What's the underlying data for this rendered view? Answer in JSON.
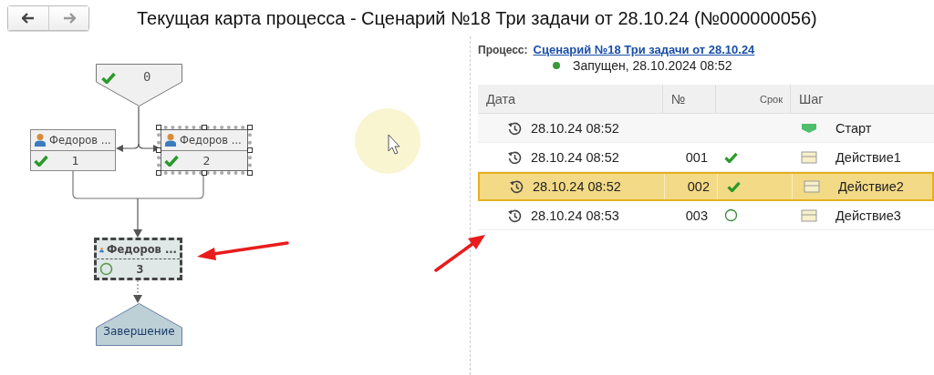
{
  "window": {
    "title": "Текущая карта процесса - Сценарий №18 Три задачи от 28.10.24 (№000000056)"
  },
  "nav": [
    {
      "kind": "back",
      "disabled": false
    },
    {
      "kind": "forward",
      "disabled": true
    }
  ],
  "diagram": {
    "nodes": [
      {
        "kind": "start",
        "label": "0",
        "done": true
      },
      {
        "kind": "task",
        "user": "Федоров ...",
        "label": "1",
        "done": true,
        "selected": false,
        "current": false
      },
      {
        "kind": "task",
        "user": "Федоров ...",
        "label": "2",
        "done": true,
        "selected": true,
        "current": false
      },
      {
        "kind": "task",
        "user": "Федоров ...",
        "label": "3",
        "done": false,
        "selected": false,
        "current": true
      },
      {
        "kind": "end",
        "label": "Завершение"
      }
    ]
  },
  "process": {
    "label": "Процесс:",
    "link": "Сценарий №18 Три задачи от 28.10.24",
    "status": "Запущен, 28.10.2024 08:52"
  },
  "table": {
    "columns": [
      "Дата",
      "№",
      "Срок",
      "Шаг"
    ],
    "rows": [
      {
        "kind": "start",
        "date": "28.10.24 08:52",
        "step": "Старт",
        "selected": false
      },
      {
        "kind": "action",
        "date": "28.10.24 08:52",
        "number": "001",
        "done": true,
        "step": "Действие1",
        "selected": false
      },
      {
        "kind": "action",
        "date": "28.10.24 08:52",
        "number": "002",
        "done": true,
        "step": "Действие2",
        "selected": true
      },
      {
        "kind": "action",
        "date": "28.10.24 08:53",
        "number": "003",
        "done": false,
        "step": "Действие3",
        "selected": false
      }
    ]
  }
}
